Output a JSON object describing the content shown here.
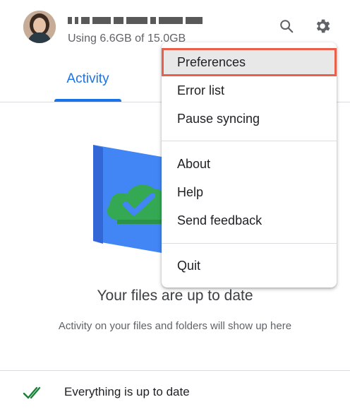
{
  "account": {
    "storage_text": "Using 6.6GB of 15.0GB"
  },
  "tabs": [
    {
      "label": "Activity",
      "active": true
    }
  ],
  "menu": {
    "items": [
      {
        "label": "Preferences",
        "selected": true
      },
      {
        "label": "Error list"
      },
      {
        "label": "Pause syncing"
      },
      {
        "label": "About"
      },
      {
        "label": "Help"
      },
      {
        "label": "Send feedback"
      },
      {
        "label": "Quit"
      }
    ]
  },
  "main": {
    "title": "Your files are up to date",
    "subtitle": "Activity on your files and folders will show up here"
  },
  "footer": {
    "status_text": "Everything is up to date"
  },
  "icons": {
    "search": "search-icon",
    "settings": "gear-icon",
    "status": "double-check-icon"
  },
  "colors": {
    "accent": "#1a73e8",
    "highlight_border": "#e8604c",
    "folder_blue": "#4285f4",
    "cloud_green": "#34a853"
  }
}
